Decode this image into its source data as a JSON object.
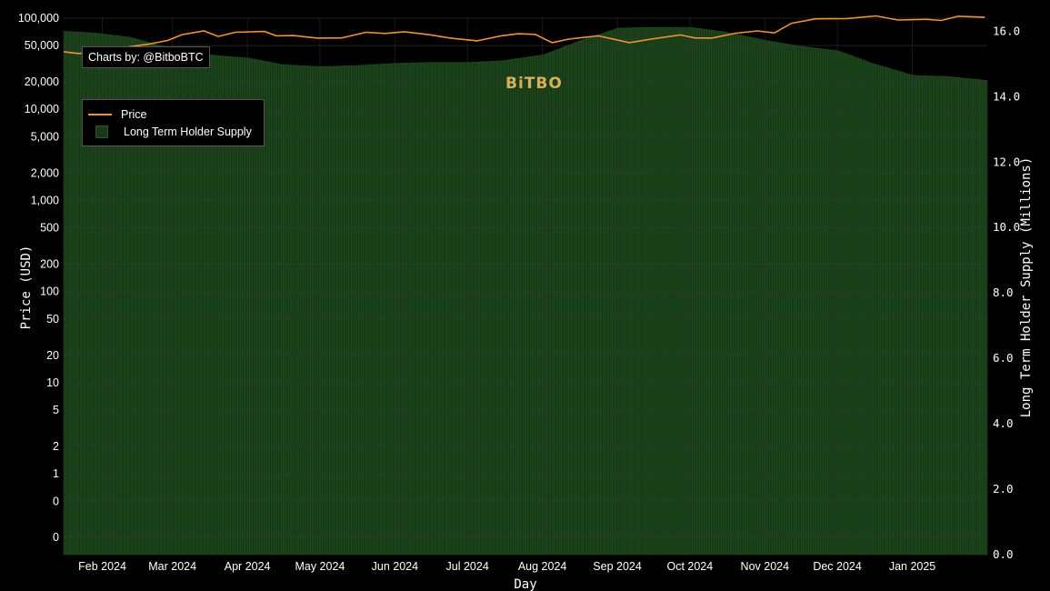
{
  "credit": "Charts by: @BitboBTC",
  "watermark": "BiTBO",
  "colors": {
    "background": "#000000",
    "price_line": "#f0923a",
    "supply_fill": "#173a17",
    "supply_stripe": "#2c5a2c",
    "grid": "#3a3a3a"
  },
  "chart_data": {
    "type": "area",
    "xlabel": "Day",
    "ylabel_left": "Price (USD)",
    "ylabel_right": "Long Term Holder Supply (Millions)",
    "x_range": [
      "2024-01-16",
      "2025-02-01"
    ],
    "x_tick_labels": [
      {
        "date": "2024-02-01",
        "label": "Feb 2024"
      },
      {
        "date": "2024-03-01",
        "label": "Mar 2024"
      },
      {
        "date": "2024-04-01",
        "label": "Apr 2024"
      },
      {
        "date": "2024-05-01",
        "label": "May 2024"
      },
      {
        "date": "2024-06-01",
        "label": "Jun 2024"
      },
      {
        "date": "2024-07-01",
        "label": "Jul 2024"
      },
      {
        "date": "2024-08-01",
        "label": "Aug 2024"
      },
      {
        "date": "2024-09-01",
        "label": "Sep 2024"
      },
      {
        "date": "2024-10-01",
        "label": "Oct 2024"
      },
      {
        "date": "2024-11-01",
        "label": "Nov 2024"
      },
      {
        "date": "2024-12-01",
        "label": "Dec 2024"
      },
      {
        "date": "2025-01-01",
        "label": "Jan 2025"
      }
    ],
    "y_left_scale": "log",
    "y_left_ticks": [
      {
        "value": 100000,
        "label": "100,000"
      },
      {
        "value": 50000,
        "label": "50,000"
      },
      {
        "value": 20000,
        "label": "20,000"
      },
      {
        "value": 10000,
        "label": "10,000"
      },
      {
        "value": 5000,
        "label": "5,000"
      },
      {
        "value": 2000,
        "label": "2,000"
      },
      {
        "value": 1000,
        "label": "1,000"
      },
      {
        "value": 500,
        "label": "500"
      },
      {
        "value": 200,
        "label": "200"
      },
      {
        "value": 100,
        "label": "100"
      },
      {
        "value": 50,
        "label": "50"
      },
      {
        "value": 20,
        "label": "20"
      },
      {
        "value": 10,
        "label": "10"
      },
      {
        "value": 5,
        "label": "5"
      },
      {
        "value": 2,
        "label": "2"
      },
      {
        "value": 1,
        "label": "1"
      },
      {
        "value": 0.5,
        "label": "0"
      },
      {
        "value": 0.2,
        "label": "0"
      }
    ],
    "y_left_range": [
      0.13,
      100000
    ],
    "y_right_range": [
      0,
      16.4
    ],
    "y_right_ticks": [
      {
        "value": 0,
        "label": "0.0"
      },
      {
        "value": 2,
        "label": "2.0"
      },
      {
        "value": 4,
        "label": "4.0"
      },
      {
        "value": 6,
        "label": "6.0"
      },
      {
        "value": 8,
        "label": "8.0"
      },
      {
        "value": 10,
        "label": "10.0"
      },
      {
        "value": 12,
        "label": "12.0"
      },
      {
        "value": 14,
        "label": "14.0"
      },
      {
        "value": 16,
        "label": "16.0"
      }
    ],
    "grid": true,
    "legend_position": "top-left",
    "series": [
      {
        "name": "Price",
        "axis": "left",
        "style": "line",
        "points": [
          [
            "2024-01-16",
            42800
          ],
          [
            "2024-01-22",
            41000
          ],
          [
            "2024-01-28",
            42000
          ],
          [
            "2024-02-05",
            43000
          ],
          [
            "2024-02-12",
            48500
          ],
          [
            "2024-02-20",
            51800
          ],
          [
            "2024-02-28",
            57000
          ],
          [
            "2024-03-05",
            66000
          ],
          [
            "2024-03-14",
            72500
          ],
          [
            "2024-03-20",
            63000
          ],
          [
            "2024-03-27",
            70000
          ],
          [
            "2024-04-08",
            71500
          ],
          [
            "2024-04-13",
            64000
          ],
          [
            "2024-04-20",
            64500
          ],
          [
            "2024-04-30",
            60500
          ],
          [
            "2024-05-10",
            60800
          ],
          [
            "2024-05-20",
            70000
          ],
          [
            "2024-05-28",
            68000
          ],
          [
            "2024-06-05",
            71000
          ],
          [
            "2024-06-15",
            66000
          ],
          [
            "2024-06-24",
            60500
          ],
          [
            "2024-07-05",
            56500
          ],
          [
            "2024-07-15",
            64000
          ],
          [
            "2024-07-22",
            67500
          ],
          [
            "2024-07-29",
            66500
          ],
          [
            "2024-08-05",
            53900
          ],
          [
            "2024-08-12",
            59000
          ],
          [
            "2024-08-24",
            64000
          ],
          [
            "2024-09-06",
            53900
          ],
          [
            "2024-09-15",
            59000
          ],
          [
            "2024-09-27",
            65500
          ],
          [
            "2024-10-03",
            60700
          ],
          [
            "2024-10-10",
            60500
          ],
          [
            "2024-10-20",
            68500
          ],
          [
            "2024-10-29",
            72500
          ],
          [
            "2024-11-05",
            69000
          ],
          [
            "2024-11-12",
            88000
          ],
          [
            "2024-11-22",
            98500
          ],
          [
            "2024-12-05",
            99000
          ],
          [
            "2024-12-17",
            106000
          ],
          [
            "2024-12-26",
            95500
          ],
          [
            "2025-01-07",
            97000
          ],
          [
            "2025-01-13",
            94500
          ],
          [
            "2025-01-20",
            105000
          ],
          [
            "2025-01-31",
            102500
          ]
        ]
      },
      {
        "name": "Long Term Holder Supply",
        "axis": "right",
        "style": "bars",
        "points": [
          [
            "2024-01-16",
            16.0
          ],
          [
            "2024-01-28",
            15.95
          ],
          [
            "2024-02-12",
            15.82
          ],
          [
            "2024-02-25",
            15.55
          ],
          [
            "2024-03-08",
            15.35
          ],
          [
            "2024-03-20",
            15.25
          ],
          [
            "2024-04-01",
            15.18
          ],
          [
            "2024-04-15",
            14.98
          ],
          [
            "2024-05-01",
            14.92
          ],
          [
            "2024-05-15",
            14.95
          ],
          [
            "2024-06-01",
            15.02
          ],
          [
            "2024-06-15",
            15.05
          ],
          [
            "2024-07-01",
            15.05
          ],
          [
            "2024-07-15",
            15.1
          ],
          [
            "2024-08-01",
            15.28
          ],
          [
            "2024-08-15",
            15.68
          ],
          [
            "2024-09-01",
            16.1
          ],
          [
            "2024-09-15",
            16.12
          ],
          [
            "2024-10-01",
            16.12
          ],
          [
            "2024-10-15",
            15.98
          ],
          [
            "2024-11-01",
            15.72
          ],
          [
            "2024-11-15",
            15.55
          ],
          [
            "2024-12-01",
            15.4
          ],
          [
            "2024-12-15",
            15.02
          ],
          [
            "2025-01-01",
            14.65
          ],
          [
            "2025-01-15",
            14.62
          ],
          [
            "2025-01-31",
            14.5
          ]
        ]
      }
    ]
  }
}
